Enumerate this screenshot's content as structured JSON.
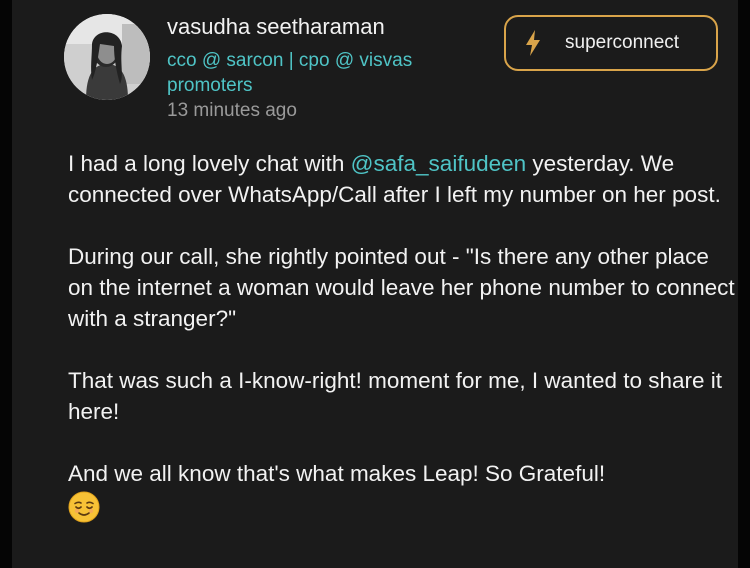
{
  "post": {
    "author": {
      "name": "vasudha seetharaman",
      "role": "cco @ sarcon | cpo @ visvas promoters",
      "timestamp": "13 minutes ago"
    },
    "action_button": {
      "label": "superconnect",
      "icon": "lightning-bolt-icon",
      "color": "#d9a44a"
    },
    "body": {
      "p1_mention": "@safa_saifudeen",
      "p1_prefix": "I had a long lovely chat with ",
      "p1_rest": " yesterday. We connected over WhatsApp/Call after I left my number on her post.",
      "p2": "During our call, she rightly pointed out - \"Is there any other place on the internet a woman would leave her phone number to connect with a stranger?\"",
      "p3": "That was such a I-know-right! moment for me, I wanted to share it here!",
      "p4": "And we all know that's what makes Leap! So Grateful!",
      "emoji": "relieved-face-icon"
    },
    "colors": {
      "background": "#1b1b1b",
      "text": "#f2f2f2",
      "accent_teal": "#4fc4c6",
      "muted": "#9a9a9a"
    }
  }
}
